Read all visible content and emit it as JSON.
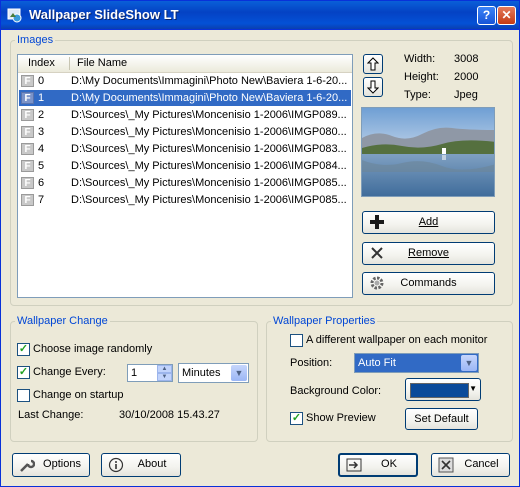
{
  "window": {
    "title": "Wallpaper SlideShow LT",
    "help": "?",
    "close": "✕"
  },
  "images": {
    "legend": "Images",
    "columns": {
      "index": "Index",
      "filename": "File Name"
    },
    "rows": [
      {
        "index": "0",
        "file": "D:\\My Documents\\Immagini\\Photo New\\Baviera 1-6-20..."
      },
      {
        "index": "1",
        "file": "D:\\My Documents\\Immagini\\Photo New\\Baviera 1-6-20..."
      },
      {
        "index": "2",
        "file": "D:\\Sources\\_My Pictures\\Moncenisio 1-2006\\IMGP089..."
      },
      {
        "index": "3",
        "file": "D:\\Sources\\_My Pictures\\Moncenisio 1-2006\\IMGP080..."
      },
      {
        "index": "4",
        "file": "D:\\Sources\\_My Pictures\\Moncenisio 1-2006\\IMGP083..."
      },
      {
        "index": "5",
        "file": "D:\\Sources\\_My Pictures\\Moncenisio 1-2006\\IMGP084..."
      },
      {
        "index": "6",
        "file": "D:\\Sources\\_My Pictures\\Moncenisio 1-2006\\IMGP085..."
      },
      {
        "index": "7",
        "file": "D:\\Sources\\_My Pictures\\Moncenisio 1-2006\\IMGP085..."
      }
    ],
    "selected_index": 1,
    "file_icon_letter": "F",
    "info": {
      "width_label": "Width:",
      "width": "3008",
      "height_label": "Height:",
      "height": "2000",
      "type_label": "Type:",
      "type": "Jpeg"
    },
    "add": "Add",
    "remove": "Remove",
    "commands": "Commands"
  },
  "wallpaper_change": {
    "legend": "Wallpaper Change",
    "choose_random": "Choose image randomly",
    "change_every": "Change Every:",
    "interval_value": "1",
    "interval_unit": "Minutes",
    "change_on_startup": "Change on startup",
    "last_change_label": "Last Change:",
    "last_change_value": "30/10/2008 15.43.27"
  },
  "wallpaper_properties": {
    "legend": "Wallpaper Properties",
    "different_each_monitor": "A different wallpaper on each monitor",
    "position_label": "Position:",
    "position_value": "Auto Fit",
    "bg_color_label": "Background Color:",
    "bg_color": "#0a4a9a",
    "show_preview": "Show Preview",
    "set_default": "Set Default"
  },
  "footer": {
    "options": "Options",
    "about": "About",
    "ok": "OK",
    "cancel": "Cancel"
  },
  "colors": {
    "accent": "#316ac5",
    "title_bar": "#0451d6",
    "group_legend": "#0046d5"
  }
}
